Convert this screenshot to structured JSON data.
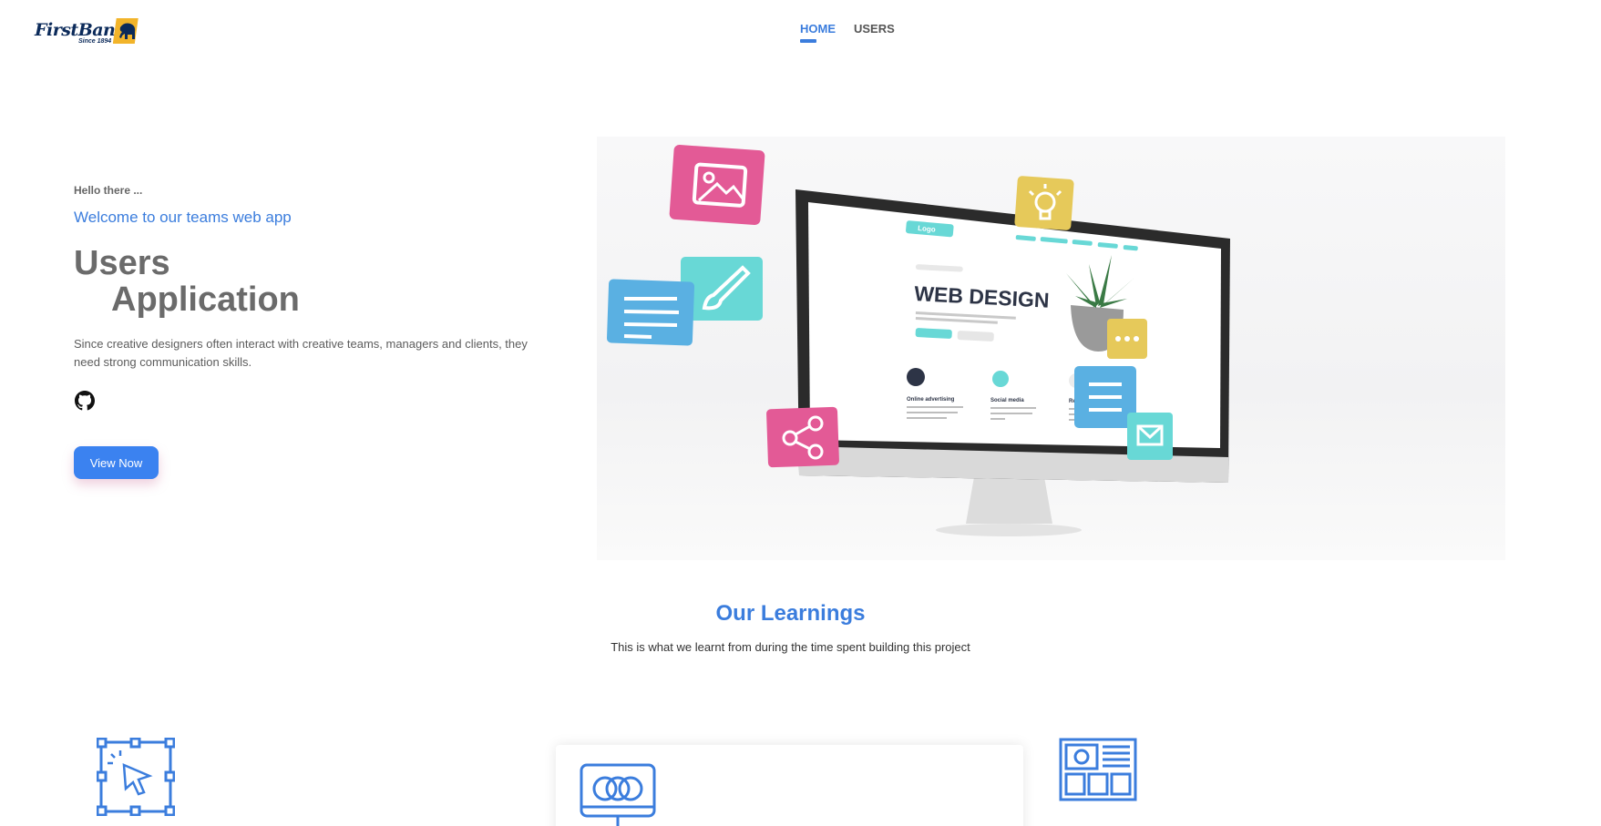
{
  "brand": {
    "name": "FirstBank",
    "tagline": "Since 1894"
  },
  "nav": {
    "items": [
      {
        "label": "HOME",
        "active": true
      },
      {
        "label": "USERS",
        "active": false
      }
    ]
  },
  "hero": {
    "greeting": "Hello there ...",
    "welcome": "Welcome to our teams web app",
    "title_line1": "Users",
    "title_line2": "Application",
    "description": "Since creative designers often interact with creative teams, managers and clients, they need strong communication skills.",
    "button_label": "View Now",
    "illustration": {
      "logo_label": "Logo",
      "headline": "WEB DESIGN",
      "features": [
        "Online advertising",
        "Social media",
        "Referral"
      ]
    }
  },
  "learnings": {
    "title": "Our Learnings",
    "subtitle": "This is what we learnt from during the time spent building this project"
  },
  "colors": {
    "accent": "#3b7ddd",
    "button": "#3b82f0",
    "pink": "#e35a96",
    "teal": "#68d8d6",
    "sky": "#5ab0e2",
    "yellow": "#e6c95a"
  },
  "icons": {
    "github": "github-icon",
    "learning_1": "design-select-icon",
    "learning_2": "monitor-rings-icon",
    "learning_3": "layout-grid-icon"
  }
}
